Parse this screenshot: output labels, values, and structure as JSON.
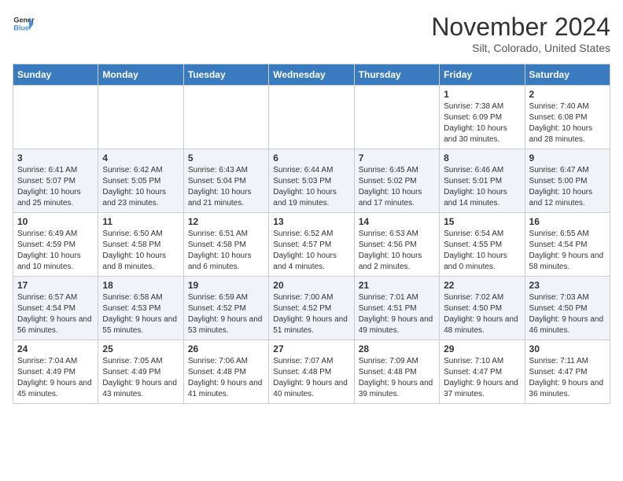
{
  "header": {
    "logo_line1": "General",
    "logo_line2": "Blue",
    "month": "November 2024",
    "location": "Silt, Colorado, United States"
  },
  "weekdays": [
    "Sunday",
    "Monday",
    "Tuesday",
    "Wednesday",
    "Thursday",
    "Friday",
    "Saturday"
  ],
  "weeks": [
    [
      {
        "day": "",
        "info": ""
      },
      {
        "day": "",
        "info": ""
      },
      {
        "day": "",
        "info": ""
      },
      {
        "day": "",
        "info": ""
      },
      {
        "day": "",
        "info": ""
      },
      {
        "day": "1",
        "info": "Sunrise: 7:38 AM\nSunset: 6:09 PM\nDaylight: 10 hours and 30 minutes."
      },
      {
        "day": "2",
        "info": "Sunrise: 7:40 AM\nSunset: 6:08 PM\nDaylight: 10 hours and 28 minutes."
      }
    ],
    [
      {
        "day": "3",
        "info": "Sunrise: 6:41 AM\nSunset: 5:07 PM\nDaylight: 10 hours and 25 minutes."
      },
      {
        "day": "4",
        "info": "Sunrise: 6:42 AM\nSunset: 5:05 PM\nDaylight: 10 hours and 23 minutes."
      },
      {
        "day": "5",
        "info": "Sunrise: 6:43 AM\nSunset: 5:04 PM\nDaylight: 10 hours and 21 minutes."
      },
      {
        "day": "6",
        "info": "Sunrise: 6:44 AM\nSunset: 5:03 PM\nDaylight: 10 hours and 19 minutes."
      },
      {
        "day": "7",
        "info": "Sunrise: 6:45 AM\nSunset: 5:02 PM\nDaylight: 10 hours and 17 minutes."
      },
      {
        "day": "8",
        "info": "Sunrise: 6:46 AM\nSunset: 5:01 PM\nDaylight: 10 hours and 14 minutes."
      },
      {
        "day": "9",
        "info": "Sunrise: 6:47 AM\nSunset: 5:00 PM\nDaylight: 10 hours and 12 minutes."
      }
    ],
    [
      {
        "day": "10",
        "info": "Sunrise: 6:49 AM\nSunset: 4:59 PM\nDaylight: 10 hours and 10 minutes."
      },
      {
        "day": "11",
        "info": "Sunrise: 6:50 AM\nSunset: 4:58 PM\nDaylight: 10 hours and 8 minutes."
      },
      {
        "day": "12",
        "info": "Sunrise: 6:51 AM\nSunset: 4:58 PM\nDaylight: 10 hours and 6 minutes."
      },
      {
        "day": "13",
        "info": "Sunrise: 6:52 AM\nSunset: 4:57 PM\nDaylight: 10 hours and 4 minutes."
      },
      {
        "day": "14",
        "info": "Sunrise: 6:53 AM\nSunset: 4:56 PM\nDaylight: 10 hours and 2 minutes."
      },
      {
        "day": "15",
        "info": "Sunrise: 6:54 AM\nSunset: 4:55 PM\nDaylight: 10 hours and 0 minutes."
      },
      {
        "day": "16",
        "info": "Sunrise: 6:55 AM\nSunset: 4:54 PM\nDaylight: 9 hours and 58 minutes."
      }
    ],
    [
      {
        "day": "17",
        "info": "Sunrise: 6:57 AM\nSunset: 4:54 PM\nDaylight: 9 hours and 56 minutes."
      },
      {
        "day": "18",
        "info": "Sunrise: 6:58 AM\nSunset: 4:53 PM\nDaylight: 9 hours and 55 minutes."
      },
      {
        "day": "19",
        "info": "Sunrise: 6:59 AM\nSunset: 4:52 PM\nDaylight: 9 hours and 53 minutes."
      },
      {
        "day": "20",
        "info": "Sunrise: 7:00 AM\nSunset: 4:52 PM\nDaylight: 9 hours and 51 minutes."
      },
      {
        "day": "21",
        "info": "Sunrise: 7:01 AM\nSunset: 4:51 PM\nDaylight: 9 hours and 49 minutes."
      },
      {
        "day": "22",
        "info": "Sunrise: 7:02 AM\nSunset: 4:50 PM\nDaylight: 9 hours and 48 minutes."
      },
      {
        "day": "23",
        "info": "Sunrise: 7:03 AM\nSunset: 4:50 PM\nDaylight: 9 hours and 46 minutes."
      }
    ],
    [
      {
        "day": "24",
        "info": "Sunrise: 7:04 AM\nSunset: 4:49 PM\nDaylight: 9 hours and 45 minutes."
      },
      {
        "day": "25",
        "info": "Sunrise: 7:05 AM\nSunset: 4:49 PM\nDaylight: 9 hours and 43 minutes."
      },
      {
        "day": "26",
        "info": "Sunrise: 7:06 AM\nSunset: 4:48 PM\nDaylight: 9 hours and 41 minutes."
      },
      {
        "day": "27",
        "info": "Sunrise: 7:07 AM\nSunset: 4:48 PM\nDaylight: 9 hours and 40 minutes."
      },
      {
        "day": "28",
        "info": "Sunrise: 7:09 AM\nSunset: 4:48 PM\nDaylight: 9 hours and 39 minutes."
      },
      {
        "day": "29",
        "info": "Sunrise: 7:10 AM\nSunset: 4:47 PM\nDaylight: 9 hours and 37 minutes."
      },
      {
        "day": "30",
        "info": "Sunrise: 7:11 AM\nSunset: 4:47 PM\nDaylight: 9 hours and 36 minutes."
      }
    ]
  ]
}
